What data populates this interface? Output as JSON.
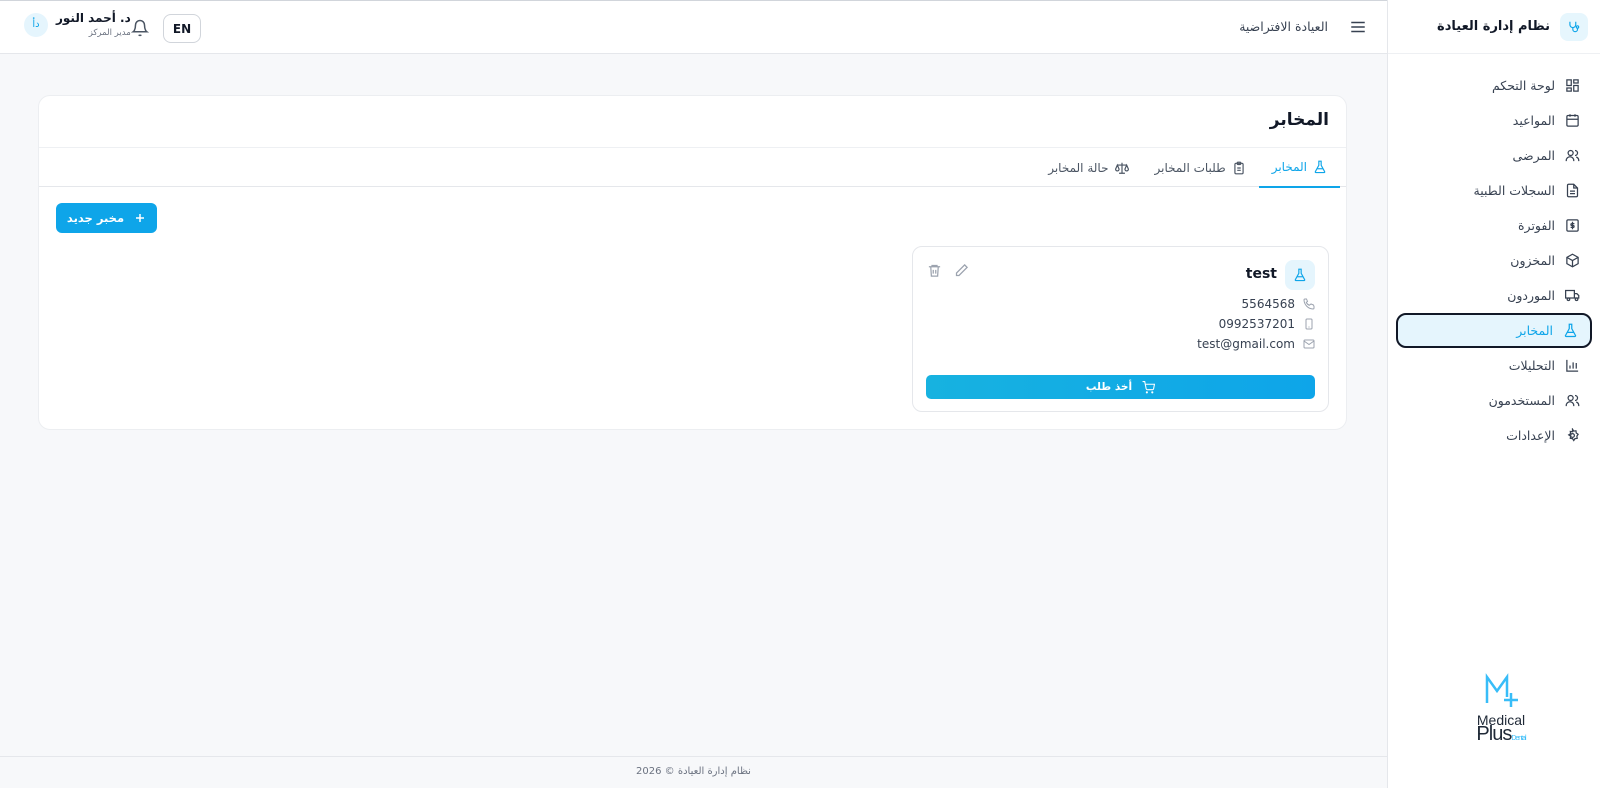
{
  "brand": {
    "title": "نظام إدارة العيادة"
  },
  "sidebar": {
    "items": [
      {
        "label": "لوحة التحكم",
        "icon": "dashboard-icon"
      },
      {
        "label": "المواعيد",
        "icon": "calendar-icon"
      },
      {
        "label": "المرضى",
        "icon": "users-icon"
      },
      {
        "label": "السجلات الطبية",
        "icon": "file-text-icon"
      },
      {
        "label": "الفوترة",
        "icon": "dollar-icon"
      },
      {
        "label": "المخزون",
        "icon": "package-icon"
      },
      {
        "label": "الموردون",
        "icon": "truck-icon"
      },
      {
        "label": "المخابر",
        "icon": "flask-icon"
      },
      {
        "label": "التحليلات",
        "icon": "bar-chart-icon"
      },
      {
        "label": "المستخدمون",
        "icon": "users-icon"
      },
      {
        "label": "الإعدادات",
        "icon": "gear-icon"
      }
    ],
    "active_index": 7,
    "logo": {
      "line1": "Medical",
      "line2": "Plus",
      "small": "Dental"
    }
  },
  "header": {
    "clinic_name": "العيادة الافتراضية",
    "language_button": "EN",
    "user_name": "د. أحمد النور",
    "user_role": "مدير المركز",
    "avatar_initials": "دأ"
  },
  "page": {
    "title": "المخابر",
    "tabs": [
      {
        "label": "المخابر",
        "active": true
      },
      {
        "label": "طلبات المخابر",
        "active": false
      },
      {
        "label": "حالة المخابر",
        "active": false
      }
    ],
    "new_button": "مخبر جديد"
  },
  "lab": {
    "name": "test",
    "phone": "5564568",
    "mobile": "0992537201",
    "email": "test@gmail.com",
    "order_button": "أخذ طلب"
  },
  "footer": {
    "text": "نظام إدارة العيادة © 2026"
  },
  "colors": {
    "accent": "#0ea5e9",
    "accent_light": "#e5f5fd"
  }
}
